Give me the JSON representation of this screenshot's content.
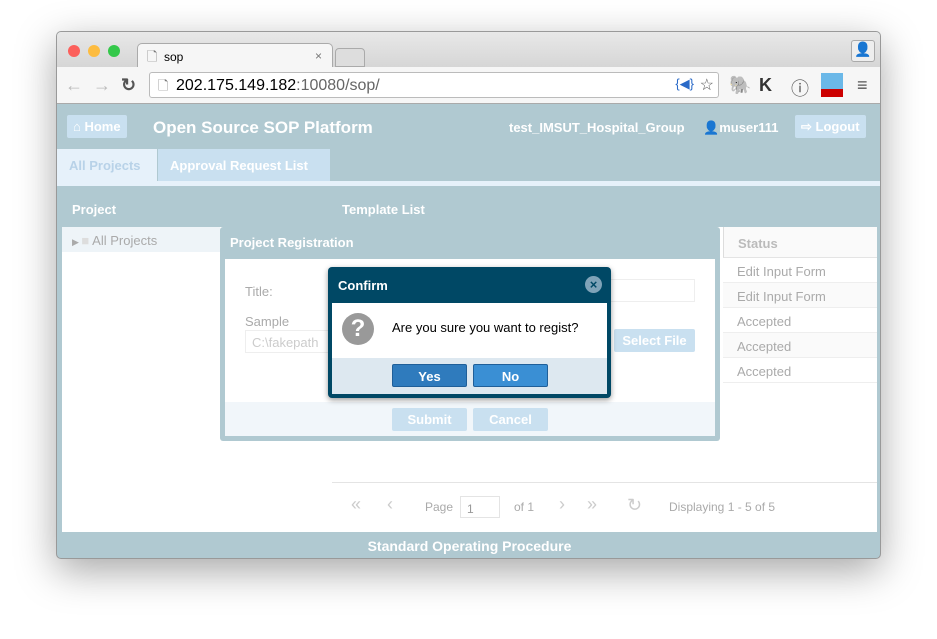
{
  "browser": {
    "tab_title": "sop",
    "url_host": "202.175.149.182",
    "url_rest": ":10080/sop/"
  },
  "header": {
    "home": "Home",
    "title": "Open Source SOP Platform",
    "group": "test_IMSUT_Hospital_Group",
    "user": "muser111",
    "logout": "Logout"
  },
  "tabs": [
    {
      "label": "All Projects",
      "active": true
    },
    {
      "label": "Approval Request List",
      "active": false
    }
  ],
  "panels": {
    "project": "Project",
    "template": "Template List"
  },
  "tree": {
    "root": "All Projects"
  },
  "status_column": {
    "header": "Status",
    "rows": [
      "Edit Input Form",
      "Edit Input Form",
      "Accepted",
      "Accepted",
      "Accepted"
    ]
  },
  "registration": {
    "title": "Project Registration",
    "title_label": "Title:",
    "sample_label": "Sample",
    "sample_value": "C:\\fakepath",
    "select_file": "Select File",
    "submit": "Submit",
    "cancel": "Cancel"
  },
  "confirm": {
    "title": "Confirm",
    "message": "Are you sure you want to regist?",
    "yes": "Yes",
    "no": "No"
  },
  "pager": {
    "page_label": "Page",
    "page": "1",
    "of": "of 1",
    "displaying": "Displaying 1 - 5 of 5"
  },
  "footer": "Standard Operating Procedure",
  "colors": {
    "app_bg": "#b0c9d1",
    "dialog_header": "#004865",
    "button": "#3a86c8"
  }
}
